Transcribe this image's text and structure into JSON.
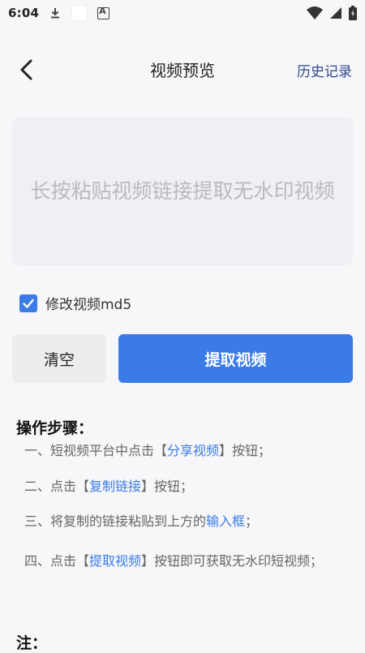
{
  "status_bar": {
    "time": "6:04"
  },
  "header": {
    "title": "视频预览",
    "history_label": "历史记录"
  },
  "input": {
    "placeholder": "长按粘贴视频链接提取无水印视频"
  },
  "md5": {
    "label": "修改视频md5",
    "checked": true
  },
  "buttons": {
    "clear": "清空",
    "extract": "提取视频"
  },
  "steps": {
    "title": "操作步骤：",
    "s1_prefix": "一、短视频平台中点击【",
    "s1_link": "分享视频",
    "s1_suffix": "】按钮；",
    "s2_prefix": "二、点击【",
    "s2_link": "复制链接",
    "s2_suffix": "】按钮；",
    "s3_prefix": "三、将复制的链接粘贴到上方的",
    "s3_link": "输入框",
    "s3_suffix": "；",
    "s4_prefix": "四、点击【",
    "s4_link": "提取视频",
    "s4_suffix": "】按钮即可获取无水印短视频；"
  },
  "note": {
    "title": "注："
  },
  "colors": {
    "accent": "#3a7be8",
    "history": "#2c4a8a",
    "background": "#f7f7f9"
  }
}
